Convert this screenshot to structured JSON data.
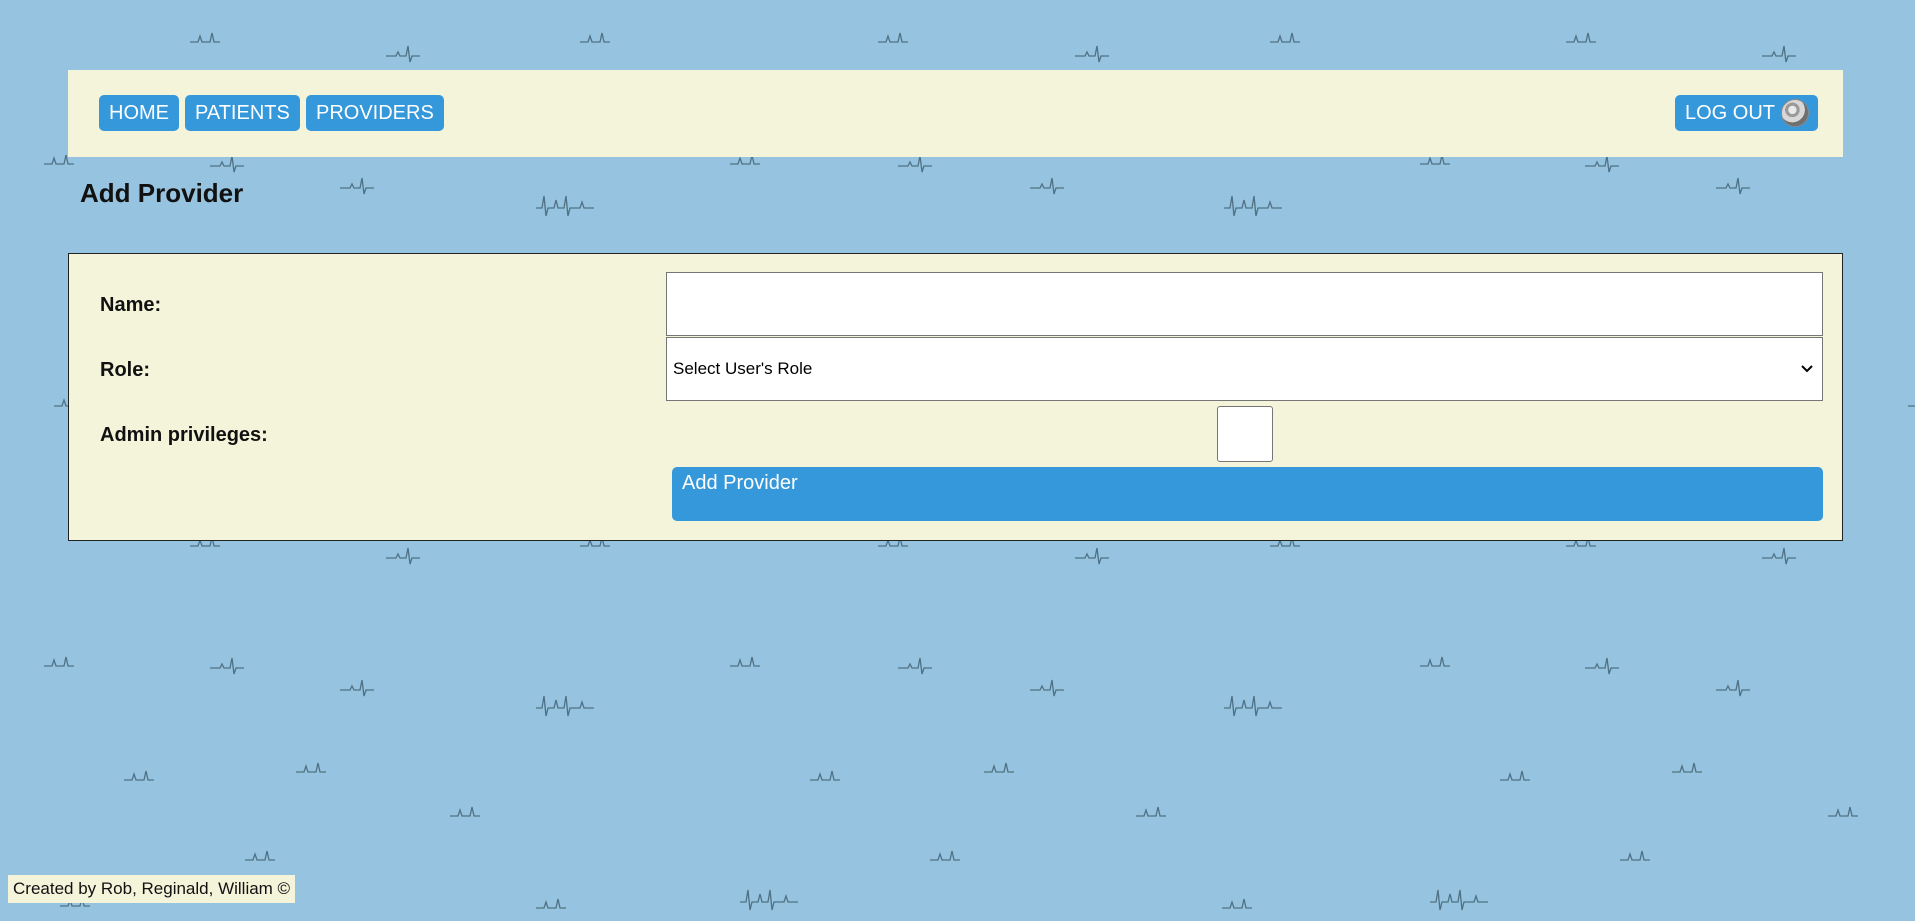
{
  "nav": {
    "home_label": "HOME",
    "patients_label": "PATIENTS",
    "providers_label": "PROVIDERS",
    "logout_label": "LOG OUT"
  },
  "page": {
    "title": "Add Provider"
  },
  "form": {
    "name_label": "Name:",
    "name_value": "",
    "role_label": "Role:",
    "role_selected": "Select User's Role",
    "admin_label": "Admin privileges:",
    "admin_checked": false,
    "submit_label": "Add Provider"
  },
  "footer": {
    "credit": "Created by Rob, Reginald, William ©"
  },
  "colors": {
    "background": "#96c3df",
    "panel": "#f4f4da",
    "accent": "#3598db"
  },
  "icons": {
    "avatar": "user-avatar-icon",
    "dropdown": "chevron-down-icon",
    "background": "heartbeat-pattern"
  }
}
